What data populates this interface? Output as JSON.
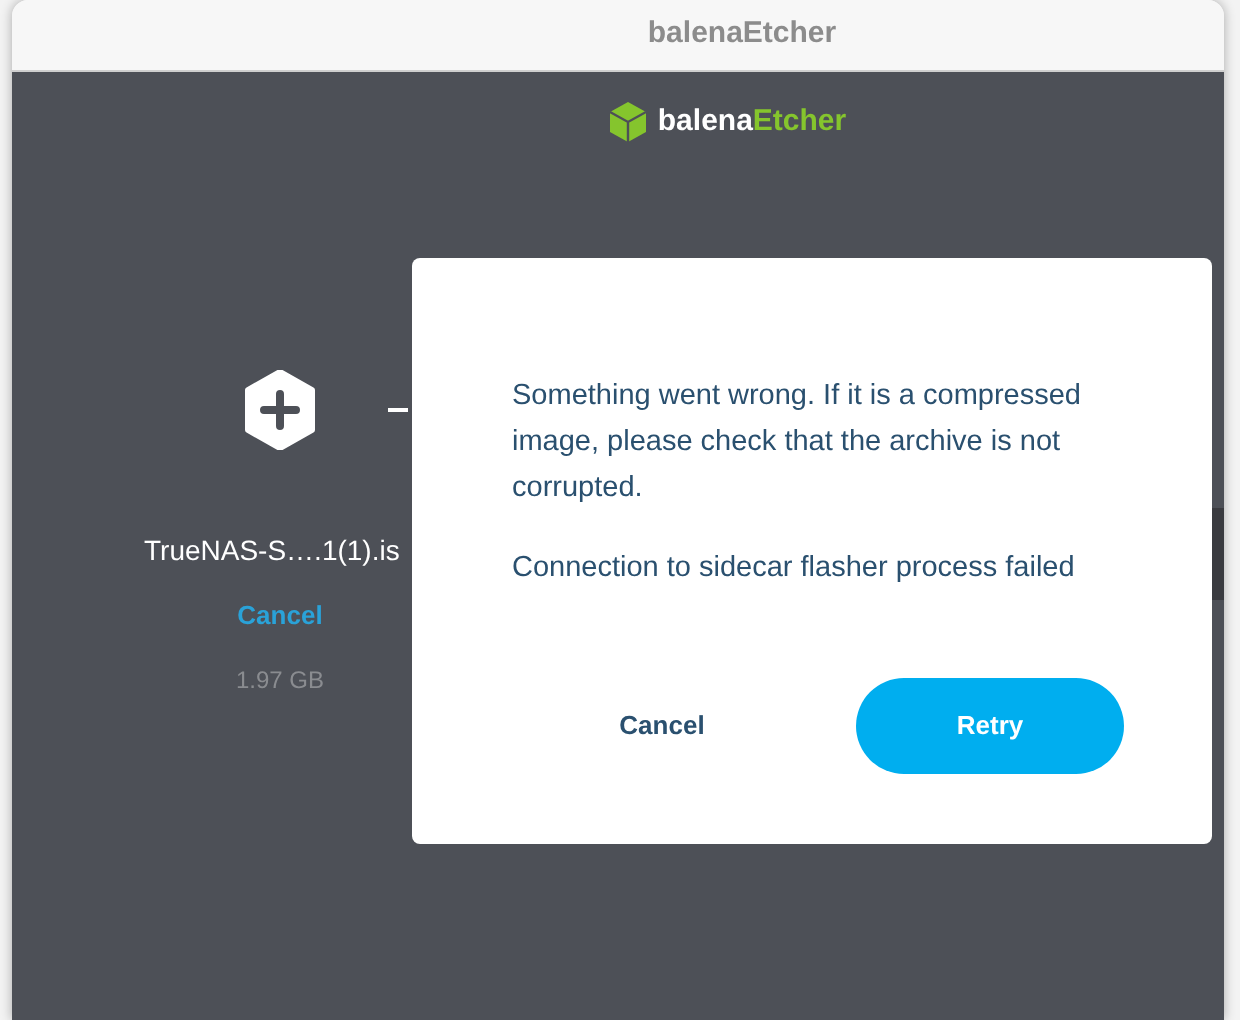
{
  "window": {
    "title": "balenaEtcher"
  },
  "logo": {
    "part_1": "balena",
    "part_2": "Etcher"
  },
  "image_step": {
    "filename": "TrueNAS-S….1(1).is",
    "action": "Cancel",
    "size": "1.97 GB"
  },
  "dialog": {
    "messages": [
      "Something went wrong. If it is a compressed image, please check that the archive is not corrupted.",
      "Connection to sidecar flasher process failed"
    ],
    "buttons": [
      {
        "label": "Cancel",
        "kind": "secondary"
      },
      {
        "label": "Retry",
        "kind": "primary"
      }
    ]
  }
}
